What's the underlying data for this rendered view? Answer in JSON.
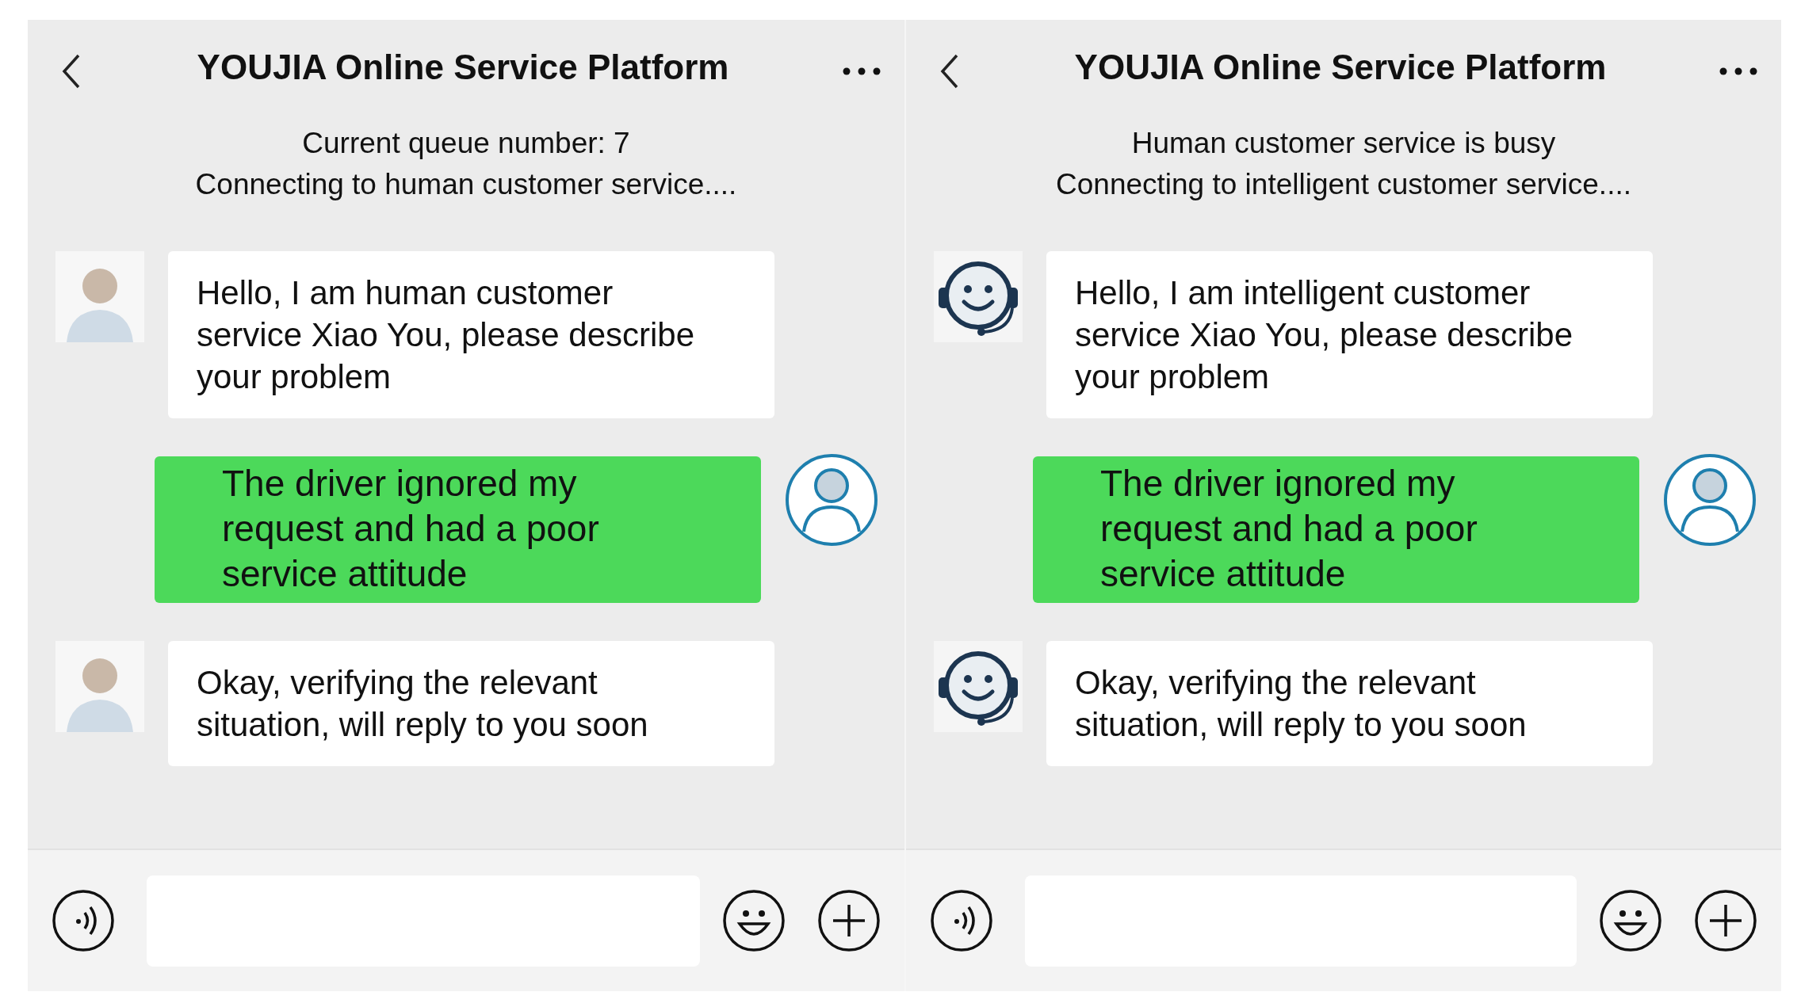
{
  "panels": [
    {
      "title": "YOUJIA Online Service Platform",
      "status_lines": [
        "Current queue number: 7",
        "Connecting to human customer service...."
      ],
      "messages": [
        {
          "kind": "human_agent",
          "text": "Hello, I am human customer service Xiao You, please describe your problem"
        },
        {
          "kind": "user",
          "text": "The driver ignored my request and had a poor service attitude"
        },
        {
          "kind": "human_agent",
          "text": "Okay, verifying the relevant situation, will reply to you soon"
        }
      ]
    },
    {
      "title": "YOUJIA Online Service Platform",
      "status_lines": [
        "Human customer service is busy",
        "Connecting to intelligent customer service...."
      ],
      "messages": [
        {
          "kind": "bot_agent",
          "text": "Hello, I am intelligent customer service Xiao You, please describe your problem"
        },
        {
          "kind": "user",
          "text": "The driver ignored my request and had a poor service attitude"
        },
        {
          "kind": "bot_agent",
          "text": "Okay, verifying the relevant situation, will reply to you soon"
        }
      ]
    }
  ]
}
